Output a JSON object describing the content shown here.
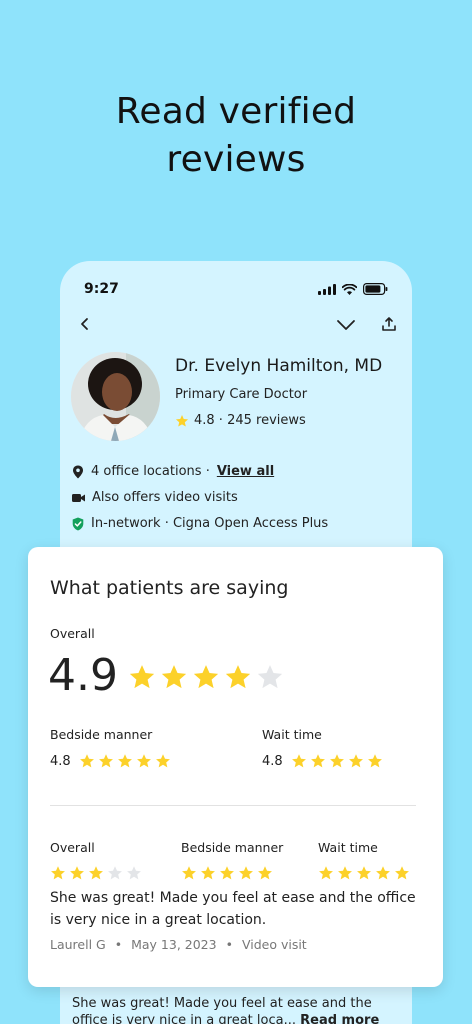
{
  "headline": {
    "line1": "Read verified",
    "line2": "reviews"
  },
  "status_bar": {
    "time": "9:27"
  },
  "doctor": {
    "name": "Dr. Evelyn Hamilton, MD",
    "specialty": "Primary Care Doctor",
    "rating_text": "4.8 · 245 reviews",
    "locations": "4 office locations ·",
    "view_all": "View all",
    "video": "Also offers video visits",
    "network": "In-network · Cigna Open Access Plus"
  },
  "summary_card": {
    "title": "What patients are saying",
    "overall_label": "Overall",
    "overall_score": "4.9",
    "overall_stars": 4,
    "bedside_label": "Bedside manner",
    "bedside_score": "4.8",
    "bedside_stars": 5,
    "wait_label": "Wait time",
    "wait_score": "4.8",
    "wait_stars": 5
  },
  "review": {
    "overall_label": "Overall",
    "overall_stars": 3,
    "bedside_label": "Bedside manner",
    "bedside_stars": 5,
    "wait_label": "Wait time",
    "wait_stars": 5,
    "text": "She was great! Made you feel at ease and the office is very nice in a great location.",
    "author": "Laurell G",
    "sep1": "•",
    "date": "May 13, 2023",
    "sep2": "•",
    "visit_type": "Video visit"
  },
  "background_review": {
    "text_start": "She was great! Made you feel at ease and the office is very nice in a great loca...",
    "read_more": "Read more"
  },
  "colors": {
    "background": "#8fe3fb",
    "phone": "#d4f4ff",
    "star": "#fcd12a",
    "star_empty": "#e3e5e8",
    "badge_green": "#13a05c"
  }
}
